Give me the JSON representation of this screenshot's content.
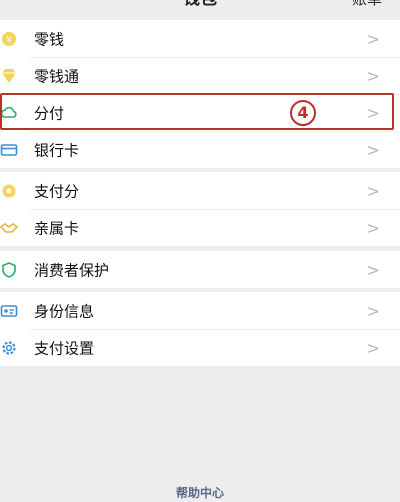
{
  "header": {
    "title": "钱包",
    "bill": "账单"
  },
  "groups": [
    {
      "items": [
        {
          "label": "零钱",
          "icon": "coin-icon"
        },
        {
          "label": "零钱通",
          "icon": "diamond-icon"
        },
        {
          "label": "分付",
          "icon": "cloud-icon"
        },
        {
          "label": "银行卡",
          "icon": "card-icon"
        }
      ]
    },
    {
      "items": [
        {
          "label": "支付分",
          "icon": "score-icon"
        },
        {
          "label": "亲属卡",
          "icon": "handshake-icon"
        }
      ]
    },
    {
      "items": [
        {
          "label": "消费者保护",
          "icon": "shield-icon"
        }
      ]
    },
    {
      "items": [
        {
          "label": "身份信息",
          "icon": "id-card-icon"
        },
        {
          "label": "支付设置",
          "icon": "gear-icon"
        }
      ]
    }
  ],
  "annotation": {
    "step": "4"
  },
  "chevron": ">",
  "footer": {
    "help": "帮助中心"
  },
  "colors": {
    "accent_yellow": "#f0c419",
    "accent_green": "#2aae67",
    "highlight_red": "#b8322a"
  }
}
